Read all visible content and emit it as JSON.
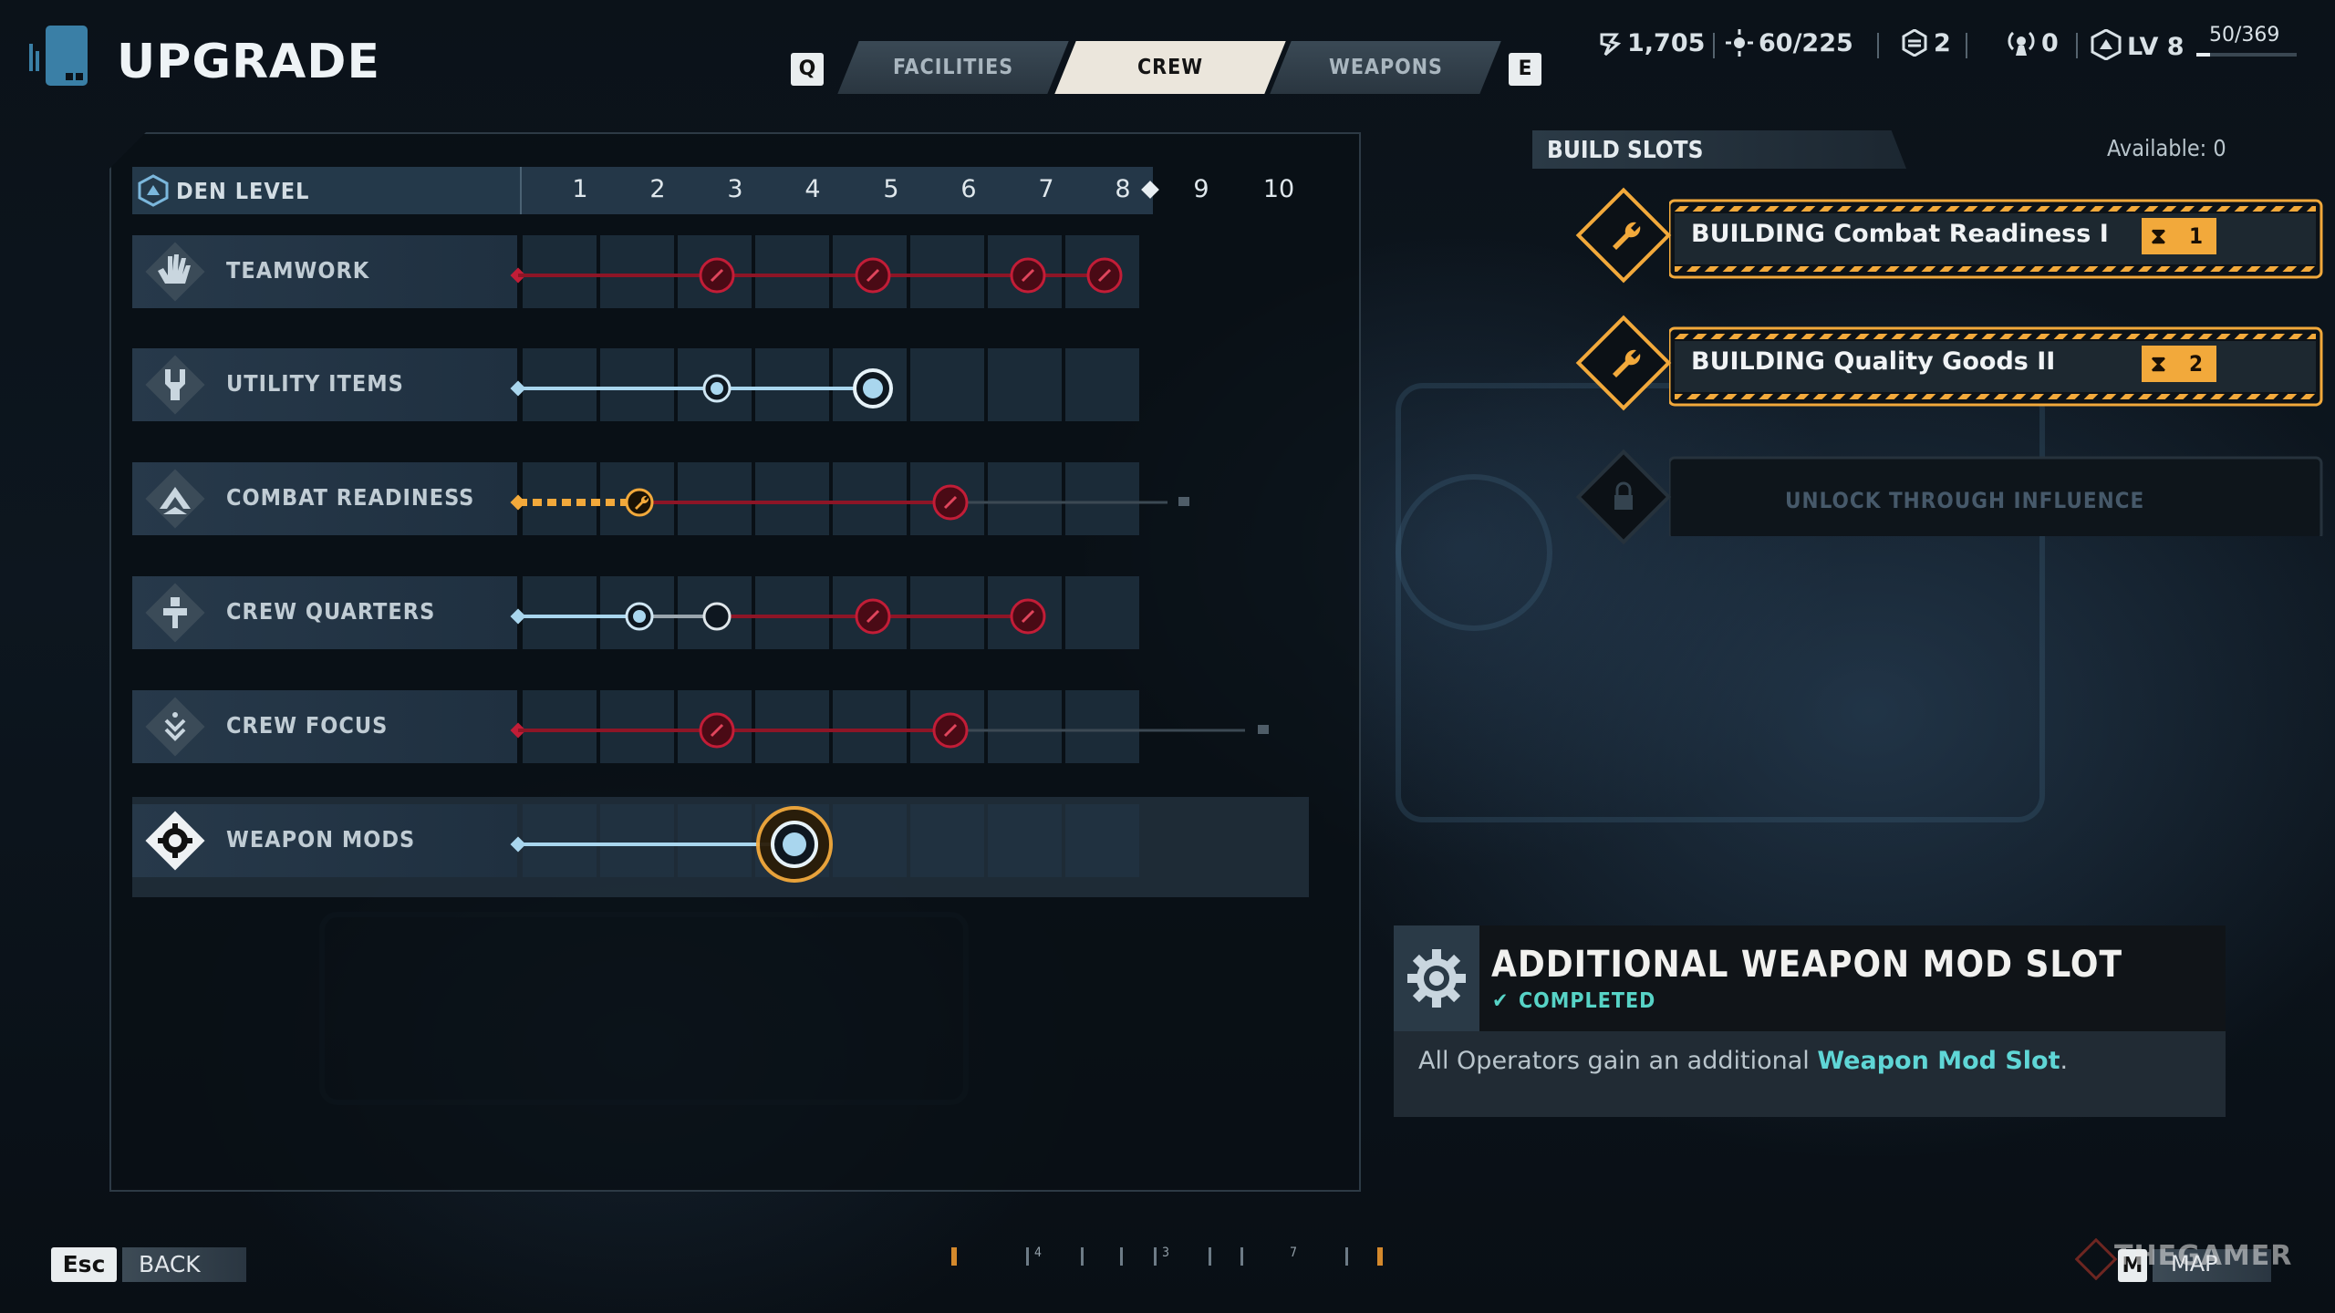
{
  "header": {
    "title": "UPGRADE",
    "prev_tab_key": "Q",
    "next_tab_key": "E",
    "tabs": [
      {
        "label": "FACILITIES",
        "active": false
      },
      {
        "label": "CREW",
        "active": true
      },
      {
        "label": "WEAPONS",
        "active": false
      }
    ],
    "stats": {
      "currency": "1,705",
      "resource": "60/225",
      "tokens": "2",
      "signals": "0",
      "level": "LV 8",
      "xp": "50/369",
      "xp_progress": 0.14
    }
  },
  "upgrade_tree": {
    "den_level_label": "DEN LEVEL",
    "levels": [
      "1",
      "2",
      "3",
      "4",
      "5",
      "6",
      "7",
      "8",
      "9",
      "10"
    ],
    "current_den_level": 8,
    "rows": [
      {
        "name": "TEAMWORK",
        "icon": "hand-icon",
        "style": "locked-red",
        "filled_to": 0,
        "nodes": [
          3,
          5,
          7,
          8
        ],
        "end_lock": false
      },
      {
        "name": "UTILITY ITEMS",
        "icon": "utility-icon",
        "style": "owned",
        "filled_to": 5,
        "nodes": [
          3,
          5
        ],
        "end_lock": false
      },
      {
        "name": "COMBAT READINESS",
        "icon": "chevron-up-icon",
        "style": "building",
        "filled_to": 2,
        "nodes": [
          2,
          6
        ],
        "end_lock": true
      },
      {
        "name": "CREW QUARTERS",
        "icon": "bed-icon",
        "style": "mixed",
        "filled_to": 2,
        "nodes": [
          2,
          3,
          5,
          7
        ],
        "end_lock": false
      },
      {
        "name": "CREW FOCUS",
        "icon": "focus-icon",
        "style": "locked-red",
        "filled_to": 0,
        "nodes": [
          3,
          6
        ],
        "end_lock": true
      },
      {
        "name": "WEAPON MODS",
        "icon": "gear-icon",
        "style": "owned-selected",
        "filled_to": 4,
        "nodes": [
          4
        ],
        "end_lock": false
      }
    ]
  },
  "build_slots": {
    "title": "BUILD SLOTS",
    "available": "Available: 0",
    "slots": [
      {
        "label": "BUILDING Combat Readiness I",
        "timer": "1"
      },
      {
        "label": "BUILDING Quality Goods II",
        "timer": "2"
      }
    ],
    "locked_label": "UNLOCK THROUGH INFLUENCE"
  },
  "detail": {
    "title": "ADDITIONAL WEAPON MOD SLOT",
    "status": "COMPLETED",
    "desc_prefix": "All Operators gain an additional ",
    "desc_highlight": "Weapon Mod Slot",
    "desc_suffix": "."
  },
  "footer": {
    "back_key": "Esc",
    "back_label": "BACK",
    "map_key": "M",
    "map_label": "MAP",
    "tick_labels": [
      "4",
      "3",
      "7"
    ],
    "watermark": "THEGAMER"
  },
  "colors": {
    "accent_orange": "#f2a93b",
    "locked_red": "#b3162e",
    "owned_blue": "#a9d6ee",
    "teal": "#57d3c6"
  }
}
